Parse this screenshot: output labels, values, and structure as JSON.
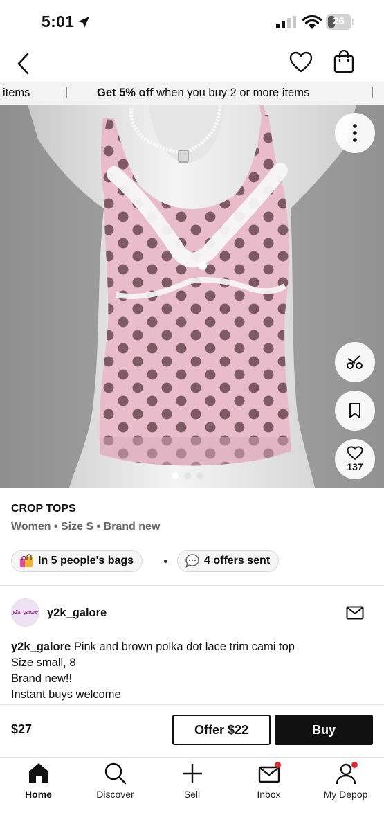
{
  "status_bar": {
    "time": "5:01",
    "battery": "26"
  },
  "promo": {
    "left_fragment": "items",
    "highlight": "Get 5% off",
    "text": " when you buy 2 or more items"
  },
  "photo": {
    "like_count": "137",
    "total_images": 4,
    "active_image": 1
  },
  "listing": {
    "category": "CROP TOPS",
    "meta": "Women • Size S • Brand new",
    "bags_chip": "In 5 people's bags",
    "offers_chip": "4 offers sent"
  },
  "seller": {
    "avatar_text": "y2k_galore",
    "name": "y2k_galore"
  },
  "description": {
    "username": "y2k_galore",
    "line1": " Pink and brown polka dot lace trim cami top",
    "line2": "Size small, 8",
    "line3": "Brand new!!",
    "line4": "Instant buys welcome"
  },
  "purchase": {
    "price": "$27",
    "offer_label": "Offer $22",
    "buy_label": "Buy"
  },
  "tabs": [
    {
      "label": "Home",
      "icon": "home-icon",
      "active": true
    },
    {
      "label": "Discover",
      "icon": "search-icon"
    },
    {
      "label": "Sell",
      "icon": "plus-icon"
    },
    {
      "label": "Inbox",
      "icon": "mail-icon",
      "badge": true
    },
    {
      "label": "My Depop",
      "icon": "person-icon",
      "badge": true
    }
  ],
  "colors": {
    "accent": "#111111",
    "badge": "#e0282e",
    "top_pink": "#e8bccb",
    "dots_brown": "#6b4a52"
  }
}
